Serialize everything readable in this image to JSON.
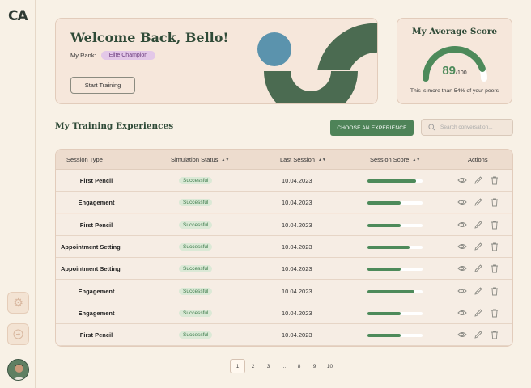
{
  "app": {
    "logo_text": "CA"
  },
  "sidebar": {
    "items": [
      {
        "name": "settings",
        "icon": "gear-icon"
      },
      {
        "name": "logout",
        "icon": "logout-icon"
      }
    ],
    "avatar_icon": "user-avatar"
  },
  "welcome": {
    "title": "Welcome Back, Bello!",
    "rank_label": "My Rank:",
    "rank_value": "Elite Champion",
    "start_button": "Start Training"
  },
  "score": {
    "title": "My Average Score",
    "value": "89",
    "max": "/100",
    "percent": 89,
    "note": "This is more than 54% of your peers"
  },
  "section": {
    "title": "My Training Experiences",
    "choose_button": "CHOOSE AN EXPERIENCE",
    "search_placeholder": "Search conversation..."
  },
  "table": {
    "headers": {
      "type": "Session Type",
      "status": "Simulation Status",
      "last": "Last Session",
      "score": "Session Score",
      "actions": "Actions"
    },
    "rows": [
      {
        "type": "First Pencil",
        "status": "Successful",
        "date": "10.04.2023",
        "score": 88
      },
      {
        "type": "Engagement",
        "status": "Successful",
        "date": "10.04.2023",
        "score": 60
      },
      {
        "type": "First Pencil",
        "status": "Successful",
        "date": "10.04.2023",
        "score": 60
      },
      {
        "type": "Appointment Setting",
        "status": "Successful",
        "date": "10.04.2023",
        "score": 77
      },
      {
        "type": "Appointment Setting",
        "status": "Successful",
        "date": "10.04.2023",
        "score": 60
      },
      {
        "type": "Engagement",
        "status": "Successful",
        "date": "10.04.2023",
        "score": 85
      },
      {
        "type": "Engagement",
        "status": "Successful",
        "date": "10.04.2023",
        "score": 60
      },
      {
        "type": "First Pencil",
        "status": "Successful",
        "date": "10.04.2023",
        "score": 60
      }
    ],
    "action_icons": [
      "eye-icon",
      "pencil-icon",
      "trash-icon"
    ]
  },
  "pagination": [
    "1",
    "2",
    "3",
    "...",
    "8",
    "9",
    "10"
  ],
  "colors": {
    "accent": "#4e8358",
    "background": "#f8f1e6",
    "card": "#f6e7db"
  }
}
